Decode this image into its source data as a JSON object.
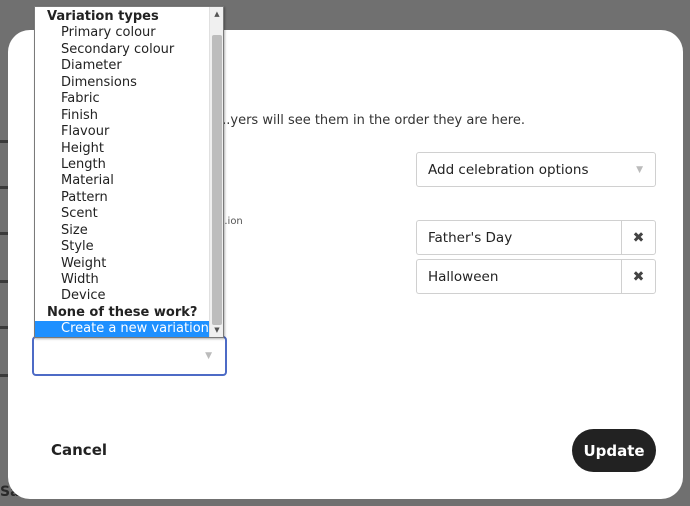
{
  "background": {
    "bottom_text": "Sa"
  },
  "modal": {
    "description": "...yers will see them in the order they are here.",
    "sub_label": "...ion",
    "celebration_select": {
      "value": "Add celebration options"
    },
    "options": [
      {
        "label": "Father's Day"
      },
      {
        "label": "Halloween"
      }
    ],
    "cancel_label": "Cancel",
    "update_label": "Update"
  },
  "dropdown": {
    "items": [
      {
        "type": "group",
        "label": "Variation types"
      },
      {
        "type": "option",
        "label": "Primary colour"
      },
      {
        "type": "option",
        "label": "Secondary colour"
      },
      {
        "type": "option",
        "label": "Diameter"
      },
      {
        "type": "option",
        "label": "Dimensions"
      },
      {
        "type": "option",
        "label": "Fabric"
      },
      {
        "type": "option",
        "label": "Finish"
      },
      {
        "type": "option",
        "label": "Flavour"
      },
      {
        "type": "option",
        "label": "Height"
      },
      {
        "type": "option",
        "label": "Length"
      },
      {
        "type": "option",
        "label": "Material"
      },
      {
        "type": "option",
        "label": "Pattern"
      },
      {
        "type": "option",
        "label": "Scent"
      },
      {
        "type": "option",
        "label": "Size"
      },
      {
        "type": "option",
        "label": "Style"
      },
      {
        "type": "option",
        "label": "Weight"
      },
      {
        "type": "option",
        "label": "Width"
      },
      {
        "type": "option",
        "label": "Device"
      },
      {
        "type": "group",
        "label": "None of these work?"
      },
      {
        "type": "option",
        "label": "Create a new variation",
        "selected": true
      }
    ]
  },
  "colors": {
    "highlight": "#1e90ff",
    "focus_border": "#4d6bc6",
    "primary_button": "#222222"
  }
}
